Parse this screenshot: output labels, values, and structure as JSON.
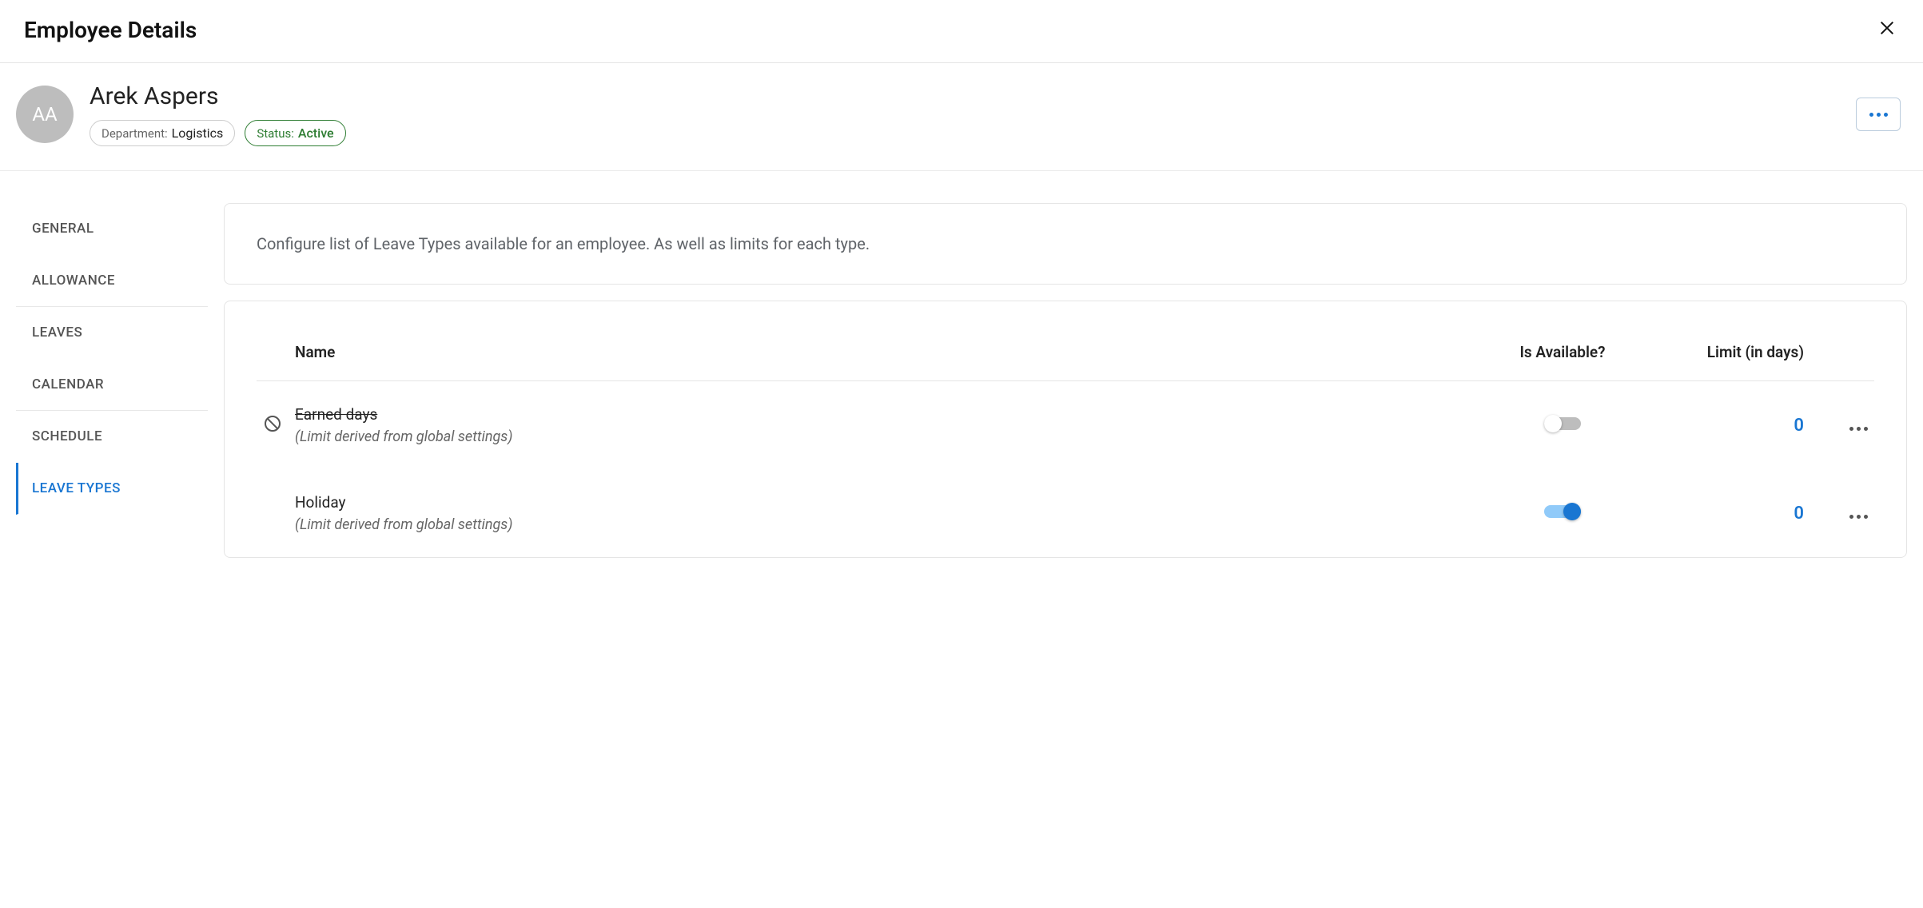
{
  "modal": {
    "title": "Employee Details"
  },
  "employee": {
    "initials": "AA",
    "name": "Arek Aspers",
    "dept_label": "Department:",
    "dept_value": "Logistics",
    "status_label": "Status:",
    "status_value": "Active"
  },
  "tabs": [
    {
      "label": "GENERAL"
    },
    {
      "label": "ALLOWANCE"
    },
    {
      "label": "LEAVES"
    },
    {
      "label": "CALENDAR"
    },
    {
      "label": "SCHEDULE"
    },
    {
      "label": "LEAVE TYPES"
    }
  ],
  "description": "Configure list of Leave Types available for an employee. As well as limits for each type.",
  "table": {
    "headers": {
      "name": "Name",
      "available": "Is Available?",
      "limit": "Limit (in days)"
    },
    "rows": [
      {
        "name": "Earned days",
        "sub": "(Limit derived from global settings)",
        "limit": "0"
      },
      {
        "name": "Holiday",
        "sub": "(Limit derived from global settings)",
        "limit": "0"
      }
    ]
  }
}
